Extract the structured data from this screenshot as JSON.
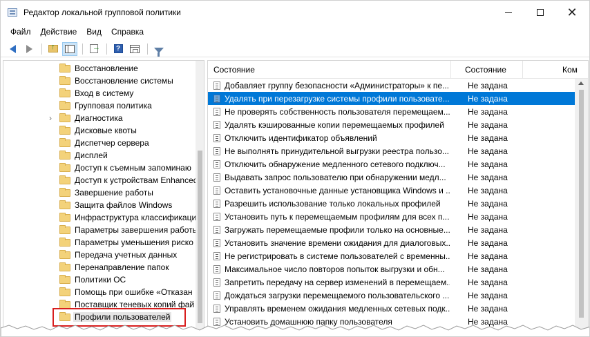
{
  "window": {
    "title": "Редактор локальной групповой политики",
    "minimize_label": "",
    "close_label": "✕"
  },
  "menu": [
    "Файл",
    "Действие",
    "Вид",
    "Справка"
  ],
  "toolbar": {
    "icons": [
      "back-arrow-icon",
      "forward-arrow-icon",
      "folder-up-icon",
      "show-hide-tree-icon",
      "export-list-icon",
      "help-icon",
      "properties-icon",
      "filter-icon"
    ],
    "help_glyph": "?"
  },
  "tree": {
    "items": [
      {
        "label": "Восстановление",
        "has_children": false,
        "selected": false
      },
      {
        "label": "Восстановление системы",
        "has_children": false,
        "selected": false
      },
      {
        "label": "Вход в систему",
        "has_children": false,
        "selected": false
      },
      {
        "label": "Групповая политика",
        "has_children": false,
        "selected": false
      },
      {
        "label": "Диагностика",
        "has_children": true,
        "selected": false
      },
      {
        "label": "Дисковые квоты",
        "has_children": false,
        "selected": false
      },
      {
        "label": "Диспетчер сервера",
        "has_children": false,
        "selected": false
      },
      {
        "label": "Дисплей",
        "has_children": false,
        "selected": false
      },
      {
        "label": "Доступ к съемным запоминаю",
        "has_children": false,
        "selected": false
      },
      {
        "label": "Доступ к устройствам Enhanced",
        "has_children": false,
        "selected": false
      },
      {
        "label": "Завершение работы",
        "has_children": false,
        "selected": false
      },
      {
        "label": "Защита файлов Windows",
        "has_children": false,
        "selected": false
      },
      {
        "label": "Инфраструктура классификаци",
        "has_children": false,
        "selected": false
      },
      {
        "label": "Параметры завершения работы",
        "has_children": false,
        "selected": false
      },
      {
        "label": "Параметры уменьшения риско",
        "has_children": false,
        "selected": false
      },
      {
        "label": "Передача учетных данных",
        "has_children": false,
        "selected": false
      },
      {
        "label": "Перенаправление папок",
        "has_children": false,
        "selected": false
      },
      {
        "label": "Политики ОС",
        "has_children": false,
        "selected": false
      },
      {
        "label": "Помощь при ошибке «Отказан",
        "has_children": false,
        "selected": false
      },
      {
        "label": "Поставщик теневых копий фай",
        "has_children": false,
        "selected": false
      },
      {
        "label": "Профили пользователей",
        "has_children": false,
        "selected": true
      }
    ],
    "expand_glyph": "›"
  },
  "list": {
    "columns": {
      "setting": "Состояние",
      "state": "Состояние",
      "comment": "Ком"
    },
    "rows": [
      {
        "name": "Добавляет группу безопасности «Администраторы» к пе...",
        "state": "Не задана",
        "selected": false
      },
      {
        "name": "Удалять при перезагрузке системы профили пользовате...",
        "state": "Не задана",
        "selected": true
      },
      {
        "name": "Не проверять собственность пользователя перемещаем...",
        "state": "Не задана",
        "selected": false
      },
      {
        "name": "Удалять кэшированные копии перемещаемых профилей",
        "state": "Не задана",
        "selected": false
      },
      {
        "name": "Отключить идентификатор объявлений",
        "state": "Не задана",
        "selected": false
      },
      {
        "name": "Не выполнять принудительной выгрузки реестра пользо...",
        "state": "Не задана",
        "selected": false
      },
      {
        "name": "Отключить обнаружение медленного сетевого подключ...",
        "state": "Не задана",
        "selected": false
      },
      {
        "name": "Выдавать запрос пользователю при обнаружении медл...",
        "state": "Не задана",
        "selected": false
      },
      {
        "name": "Оставить установочные данные установщика Windows и ...",
        "state": "Не задана",
        "selected": false
      },
      {
        "name": "Разрешить использование только локальных профилей",
        "state": "Не задана",
        "selected": false
      },
      {
        "name": "Установить путь к перемещаемым профилям для всех п...",
        "state": "Не задана",
        "selected": false
      },
      {
        "name": "Загружать перемещаемые профили только на основные...",
        "state": "Не задана",
        "selected": false
      },
      {
        "name": "Установить значение времени ожидания для диалоговых...",
        "state": "Не задана",
        "selected": false
      },
      {
        "name": "Не регистрировать в системе пользователей с временны...",
        "state": "Не задана",
        "selected": false
      },
      {
        "name": "Максимальное число повторов попыток выгрузки и обн...",
        "state": "Не задана",
        "selected": false
      },
      {
        "name": "Запретить передачу на сервер изменений в перемещаем...",
        "state": "Не задана",
        "selected": false
      },
      {
        "name": "Дождаться загрузки перемещаемого пользовательского ...",
        "state": "Не задана",
        "selected": false
      },
      {
        "name": "Управлять временем ожидания медленных сетевых подк...",
        "state": "Не задана",
        "selected": false
      },
      {
        "name": "Установить домашнюю папку пользователя",
        "state": "Не задана",
        "selected": false
      }
    ]
  },
  "colors": {
    "selection": "#0078d7",
    "annotation": "#d81e1e",
    "folder": "#f3d27a"
  }
}
